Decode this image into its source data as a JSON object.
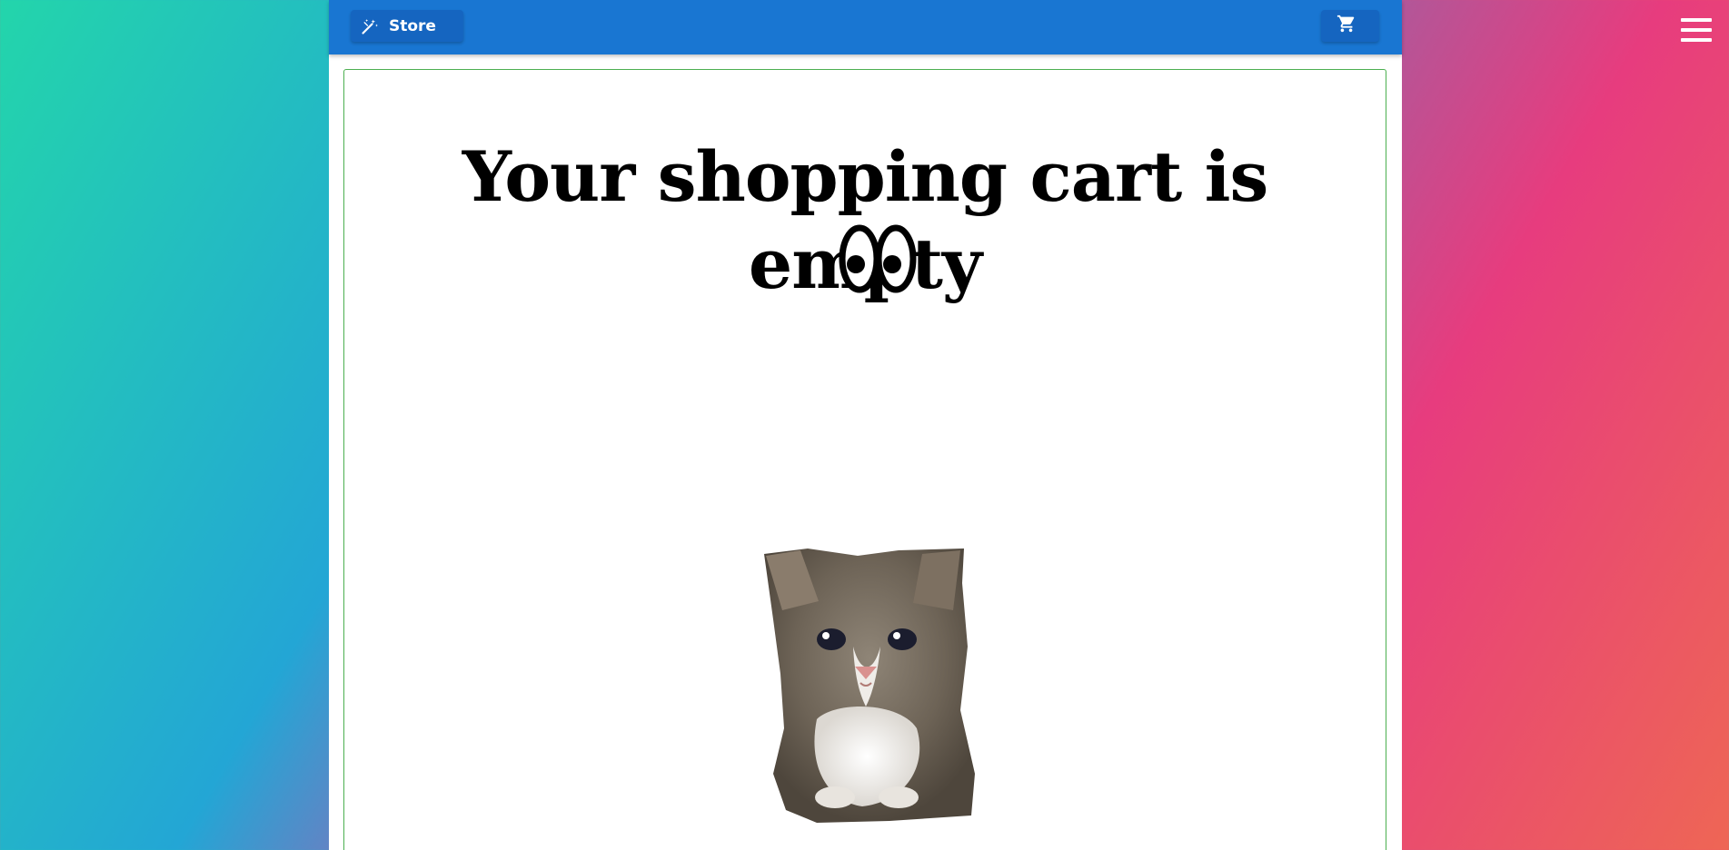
{
  "header": {
    "store_label": "Store",
    "store_icon": "magic-wand-icon",
    "cart_icon": "shopping-cart-icon",
    "bar_color": "#1976d2"
  },
  "menu": {
    "icon": "hamburger-menu-icon"
  },
  "cart": {
    "empty_message": "Your shopping cart is empty",
    "emoji_icon": "eyes-icon",
    "illustration": "crying-kitten-image",
    "card_border_color": "#4caf50"
  }
}
